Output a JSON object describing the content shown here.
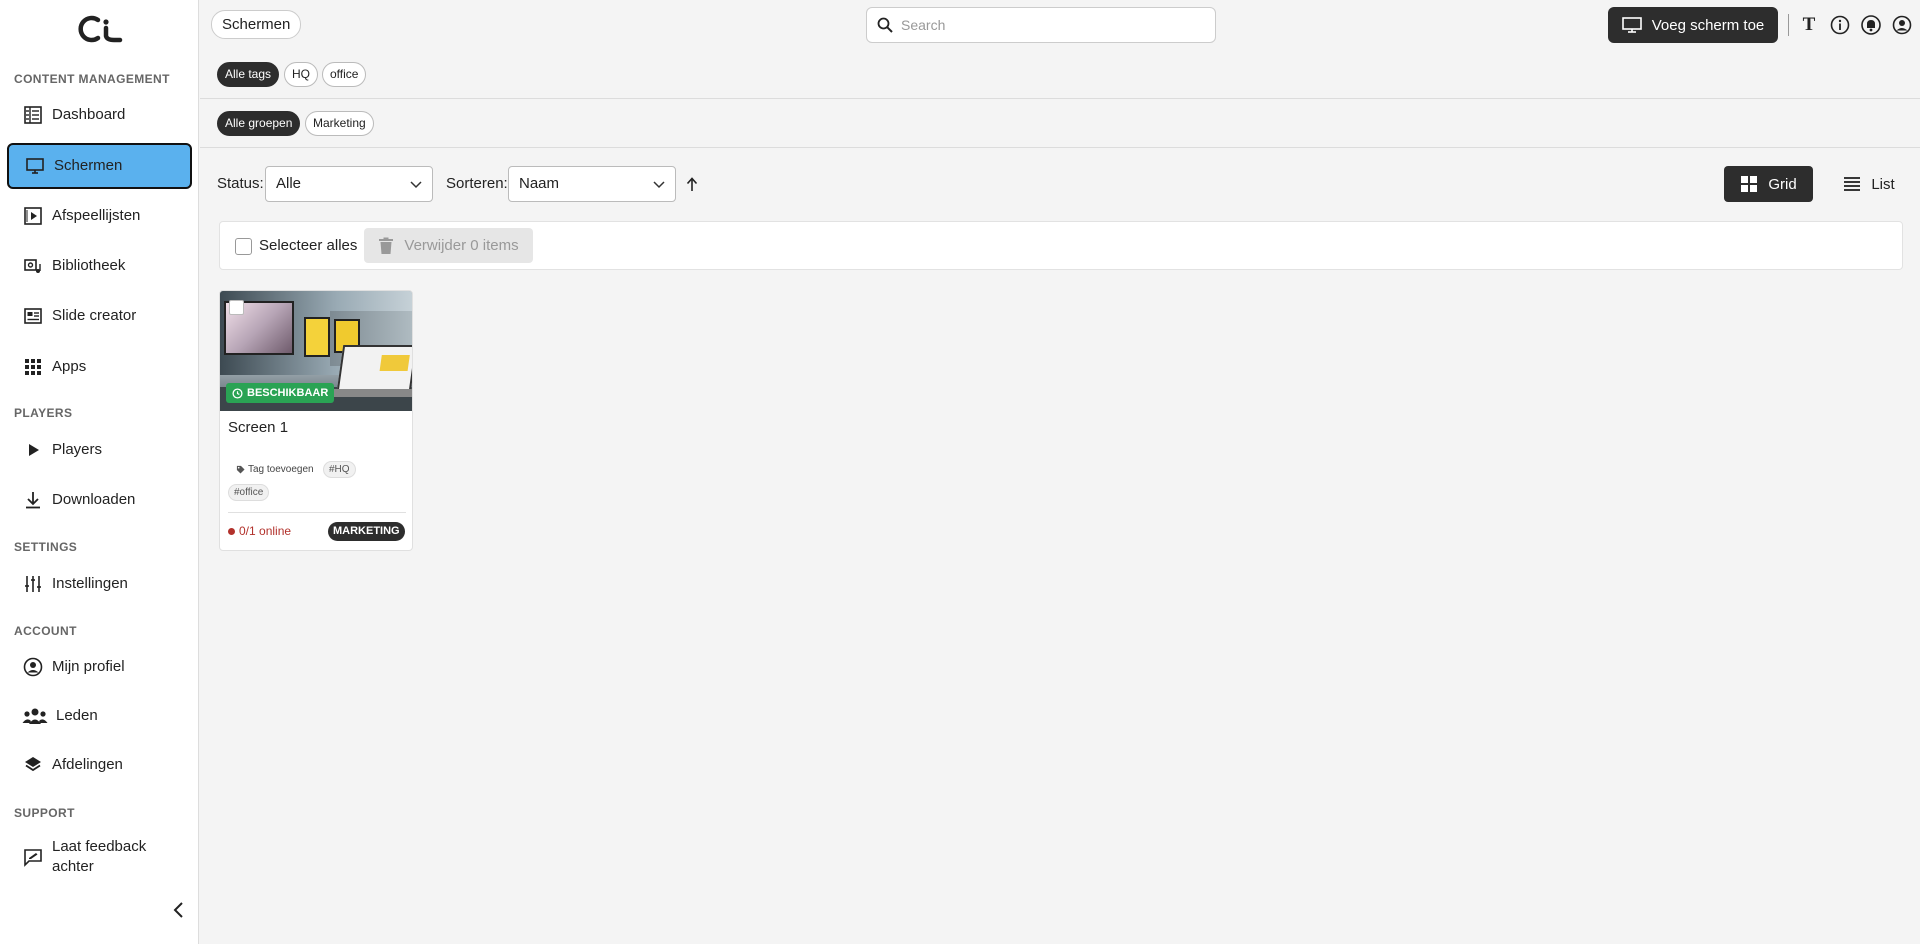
{
  "sidebar": {
    "sections": {
      "content": "CONTENT MANAGEMENT",
      "players": "PLAYERS",
      "settings": "SETTINGS",
      "account": "ACCOUNT",
      "support": "SUPPORT"
    },
    "items": {
      "dashboard": "Dashboard",
      "schermen": "Schermen",
      "afspeellijsten": "Afspeellijsten",
      "bibliotheek": "Bibliotheek",
      "slide_creator": "Slide creator",
      "apps": "Apps",
      "players": "Players",
      "downloaden": "Downloaden",
      "instellingen": "Instellingen",
      "mijn_profiel": "Mijn profiel",
      "leden": "Leden",
      "afdelingen": "Afdelingen",
      "feedback_line1": "Laat feedback",
      "feedback_line2": "achter"
    },
    "active_item": "schermen",
    "active_color": "#5ab1ee"
  },
  "header": {
    "breadcrumb": "Schermen",
    "search_placeholder": "Search",
    "add_button": "Voeg scherm toe",
    "text_icon_glyph": "T"
  },
  "filters": {
    "tags": [
      "Alle tags",
      "HQ",
      "office"
    ],
    "groups": [
      "Alle groepen",
      "Marketing"
    ]
  },
  "controls": {
    "status_label": "Status:",
    "status_value": "Alle",
    "sort_label": "Sorteren:",
    "sort_value": "Naam",
    "grid_label": "Grid",
    "list_label": "List"
  },
  "bulk": {
    "select_all": "Selecteer alles",
    "delete_label": "Verwijder 0 items"
  },
  "screens": [
    {
      "title": "Screen 1",
      "status": "BESCHIKBAAR",
      "tag_add": "Tag toevoegen",
      "tags": [
        "#HQ",
        "#office"
      ],
      "online": "0/1 online",
      "group": "MARKETING"
    }
  ],
  "colors": {
    "dark": "#2d2d2d",
    "available": "#2aa354",
    "offline": "#b2312b"
  }
}
